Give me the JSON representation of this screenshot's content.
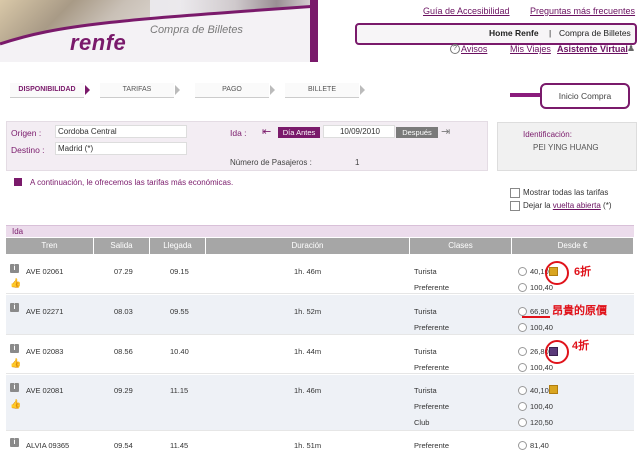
{
  "header": {
    "logo": "renfe",
    "banner_title": "Compra de Billetes",
    "links": {
      "accesibilidad": "Guía de Accesibilidad",
      "preguntas": "Preguntas más frecuentes"
    },
    "breadcrumb": {
      "home": "Home Renfe",
      "separator": "|",
      "current": "Compra de Billetes"
    },
    "user_links": {
      "avisos": "Avisos",
      "mis_viajes": "Mis Viajes",
      "asistente": "Asistente Virtual"
    }
  },
  "steps": [
    {
      "label": "DISPONIBILIDAD",
      "active": true
    },
    {
      "label": "TARIFAS",
      "active": false
    },
    {
      "label": "PAGO",
      "active": false
    },
    {
      "label": "BILLETE",
      "active": false
    }
  ],
  "inicio_compra": "Inicio Compra",
  "search": {
    "origen_label": "Origen :",
    "origen_value": "Cordoba Central",
    "destino_label": "Destino :",
    "destino_value": "Madrid (*)",
    "ida_label": "Ida :",
    "dia_antes": "Día Antes",
    "fecha": "10/09/2010",
    "despues": "Después",
    "pasajeros_label": "Número de Pasajeros :",
    "pasajeros_value": "1"
  },
  "identificacion": {
    "label": "Identificación:",
    "name": "PEI YING HUANG"
  },
  "info_text": "A continuación, le ofrecemos las tarifas más económicas.",
  "options": {
    "mostrar": "Mostrar todas las tarifas",
    "dejar_pre": "Dejar la ",
    "dejar_link": "vuelta abierta",
    "dejar_post": " (*)"
  },
  "table": {
    "section": "Ida",
    "columns": [
      "Tren",
      "Salida",
      "Llegada",
      "Duración",
      "Clases",
      "Desde €"
    ],
    "rows": [
      {
        "tren": "AVE 02061",
        "salida": "07.29",
        "llegada": "09.15",
        "duracion": "1h. 46m",
        "clases": [
          "Turista",
          "Preferente"
        ],
        "precios": [
          "40,10",
          "100,40"
        ]
      },
      {
        "tren": "AVE 02271",
        "salida": "08.03",
        "llegada": "09.55",
        "duracion": "1h. 52m",
        "clases": [
          "Turista",
          "Preferente"
        ],
        "precios": [
          "66,90",
          "100,40"
        ]
      },
      {
        "tren": "AVE 02083",
        "salida": "08.56",
        "llegada": "10.40",
        "duracion": "1h. 44m",
        "clases": [
          "Turista",
          "Preferente"
        ],
        "precios": [
          "26,80",
          "100,40"
        ]
      },
      {
        "tren": "AVE 02081",
        "salida": "09.29",
        "llegada": "11.15",
        "duracion": "1h. 46m",
        "clases": [
          "Turista",
          "Preferente",
          "Club"
        ],
        "precios": [
          "40,10",
          "100,40",
          "120,50"
        ]
      },
      {
        "tren": "ALVIA 09365",
        "salida": "09.54",
        "llegada": "11.45",
        "duracion": "1h. 51m",
        "clases": [
          "Preferente"
        ],
        "precios": [
          "81,40"
        ]
      }
    ]
  },
  "annotations": {
    "a1": "6折",
    "a2": "昂貴的原價",
    "a3": "4折"
  },
  "colors": {
    "brand": "#7a1a6b",
    "annotation": "#e0121a",
    "header_gray": "#a6a6a6"
  }
}
